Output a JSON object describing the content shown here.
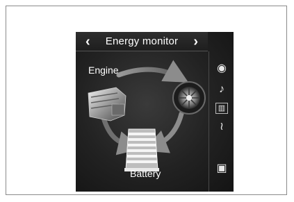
{
  "header": {
    "title": "Energy monitor",
    "prev_glyph": "‹",
    "next_glyph": "›"
  },
  "diagram": {
    "engine_label": "Engine",
    "battery_label": "Battery"
  },
  "sidebar": {
    "items": [
      {
        "name": "navigation-icon",
        "glyph": "◉"
      },
      {
        "name": "audio-icon",
        "glyph": "♪"
      },
      {
        "name": "energy-monitor-icon",
        "glyph": "▥"
      },
      {
        "name": "climate-icon",
        "glyph": "≀"
      },
      {
        "name": "screen-icon",
        "glyph": "▣"
      }
    ]
  }
}
